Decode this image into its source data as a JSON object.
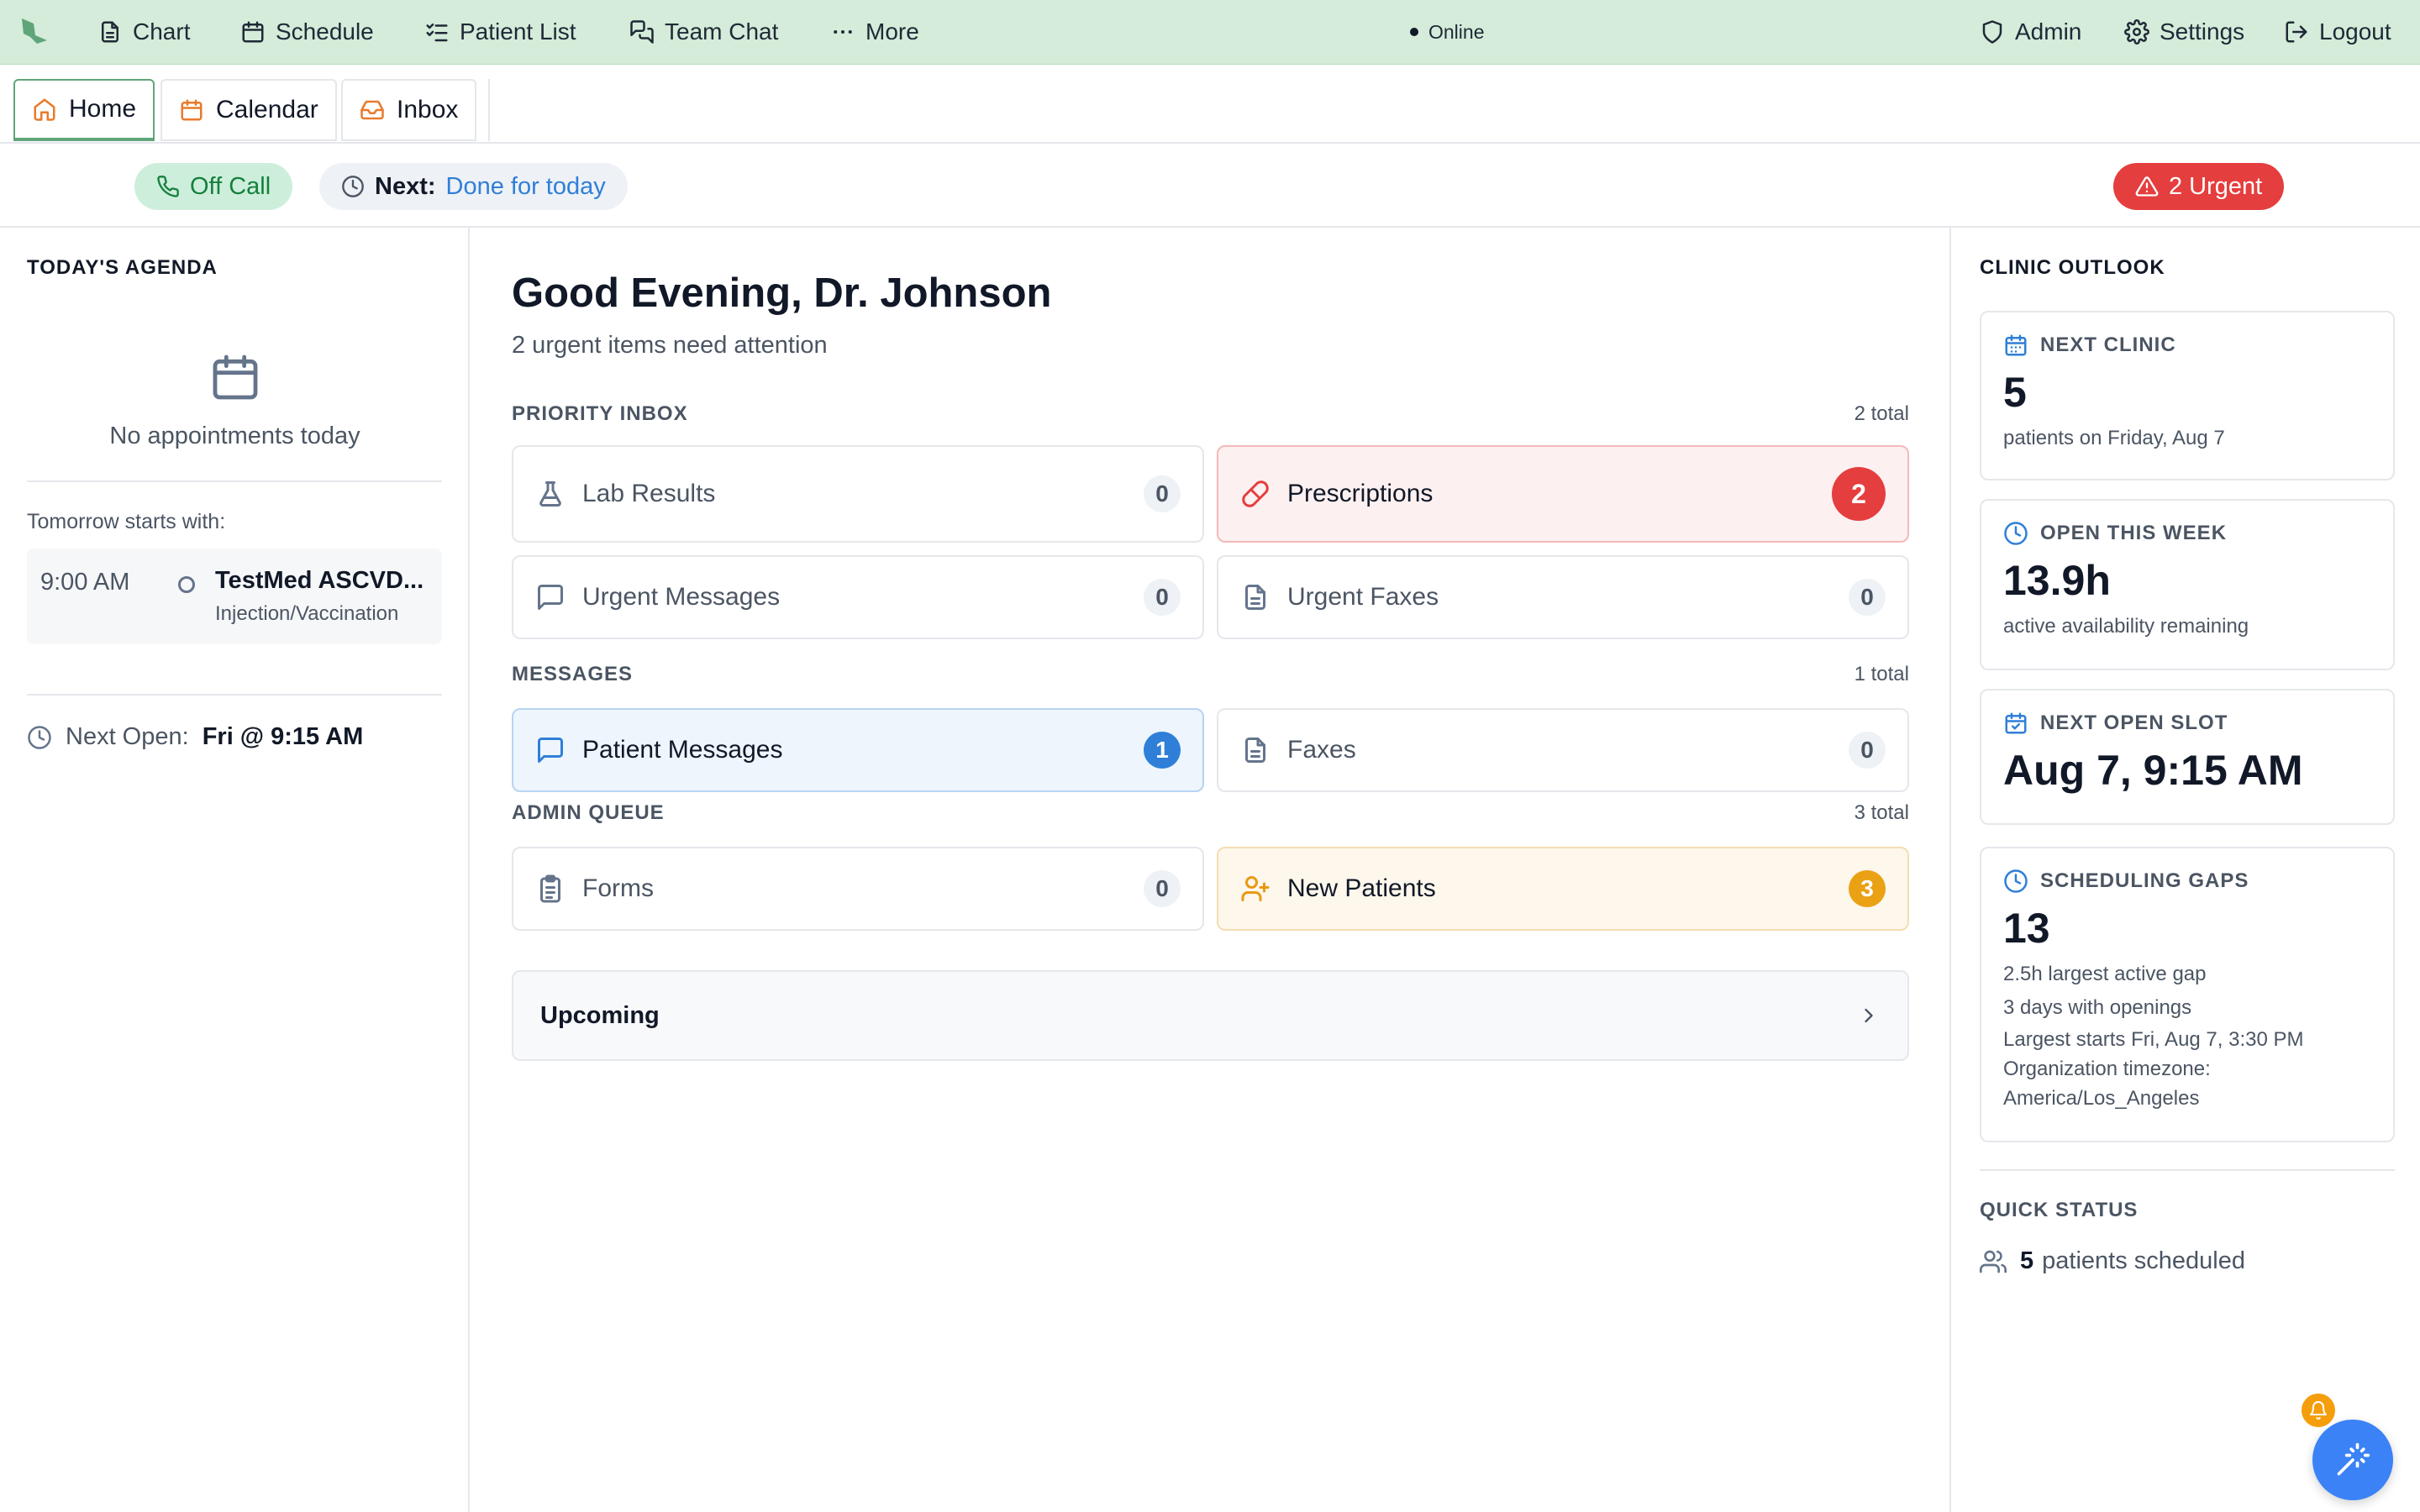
{
  "nav": {
    "items": [
      {
        "label": "Chart",
        "icon": "document-icon"
      },
      {
        "label": "Schedule",
        "icon": "calendar-icon"
      },
      {
        "label": "Patient List",
        "icon": "list-check-icon"
      },
      {
        "label": "Team Chat",
        "icon": "chat-icon"
      },
      {
        "label": "More",
        "icon": "ellipsis-icon"
      }
    ],
    "status": "Online",
    "right": [
      {
        "label": "Admin",
        "icon": "shield-icon"
      },
      {
        "label": "Settings",
        "icon": "gear-icon"
      },
      {
        "label": "Logout",
        "icon": "logout-icon"
      }
    ]
  },
  "tabs": [
    {
      "label": "Home",
      "icon": "home-icon",
      "active": true
    },
    {
      "label": "Calendar",
      "icon": "calendar-icon",
      "active": false
    },
    {
      "label": "Inbox",
      "icon": "inbox-icon",
      "active": false
    }
  ],
  "status_bar": {
    "call_status": "Off Call",
    "next_label": "Next:",
    "next_value": "Done for today",
    "urgent": "2 Urgent"
  },
  "agenda": {
    "title": "TODAY'S AGENDA",
    "empty": "No appointments today",
    "tomorrow_label": "Tomorrow starts with:",
    "tomorrow_appt": {
      "time": "9:00 AM",
      "title": "TestMed ASCVD...",
      "type": "Injection/Vaccination"
    },
    "next_open_label": "Next Open:",
    "next_open_value": "Fri @ 9:15 AM"
  },
  "main": {
    "greeting": "Good Evening, Dr. Johnson",
    "subtitle": "2 urgent items need attention",
    "priority_inbox": {
      "title": "PRIORITY INBOX",
      "count": "2 total",
      "items": [
        {
          "label": "Lab Results",
          "count": "0",
          "icon": "flask-icon"
        },
        {
          "label": "Prescriptions",
          "count": "2",
          "icon": "pill-icon"
        },
        {
          "label": "Urgent Messages",
          "count": "0",
          "icon": "message-icon"
        },
        {
          "label": "Urgent Faxes",
          "count": "0",
          "icon": "file-icon"
        }
      ]
    },
    "messages": {
      "title": "MESSAGES",
      "count": "1 total",
      "items": [
        {
          "label": "Patient Messages",
          "count": "1",
          "icon": "message-icon"
        },
        {
          "label": "Faxes",
          "count": "0",
          "icon": "file-icon"
        }
      ]
    },
    "admin_queue": {
      "title": "ADMIN QUEUE",
      "count": "3 total",
      "items": [
        {
          "label": "Forms",
          "count": "0",
          "icon": "clipboard-icon"
        },
        {
          "label": "New Patients",
          "count": "3",
          "icon": "user-plus-icon"
        }
      ]
    },
    "upcoming": "Upcoming"
  },
  "outlook": {
    "title": "CLINIC OUTLOOK",
    "cards": [
      {
        "title": "NEXT CLINIC",
        "value": "5",
        "sub": "patients on Friday, Aug 7",
        "icon": "calendar-icon"
      },
      {
        "title": "OPEN THIS WEEK",
        "value": "13.9h",
        "sub": "active availability remaining",
        "icon": "clock-icon"
      },
      {
        "title": "NEXT OPEN SLOT",
        "value": "Aug 7, 9:15 AM",
        "icon": "calendar-check-icon"
      },
      {
        "title": "SCHEDULING GAPS",
        "value": "13",
        "sub": "2.5h largest active gap",
        "line2": "3 days with openings",
        "line3": "Largest starts Fri, Aug 7, 3:30 PM",
        "line4": "Organization timezone: America/Los_Angeles",
        "icon": "clock-icon"
      }
    ],
    "quick_status_title": "QUICK STATUS",
    "quick_count": "5",
    "quick_label": "patients scheduled"
  },
  "colors": {
    "brand_green": "#5fa579",
    "topbar_bg": "#d4ecd9",
    "urgent_red": "#e53e3e",
    "info_blue": "#2f7fd8",
    "warn_amber": "#eaa114"
  }
}
